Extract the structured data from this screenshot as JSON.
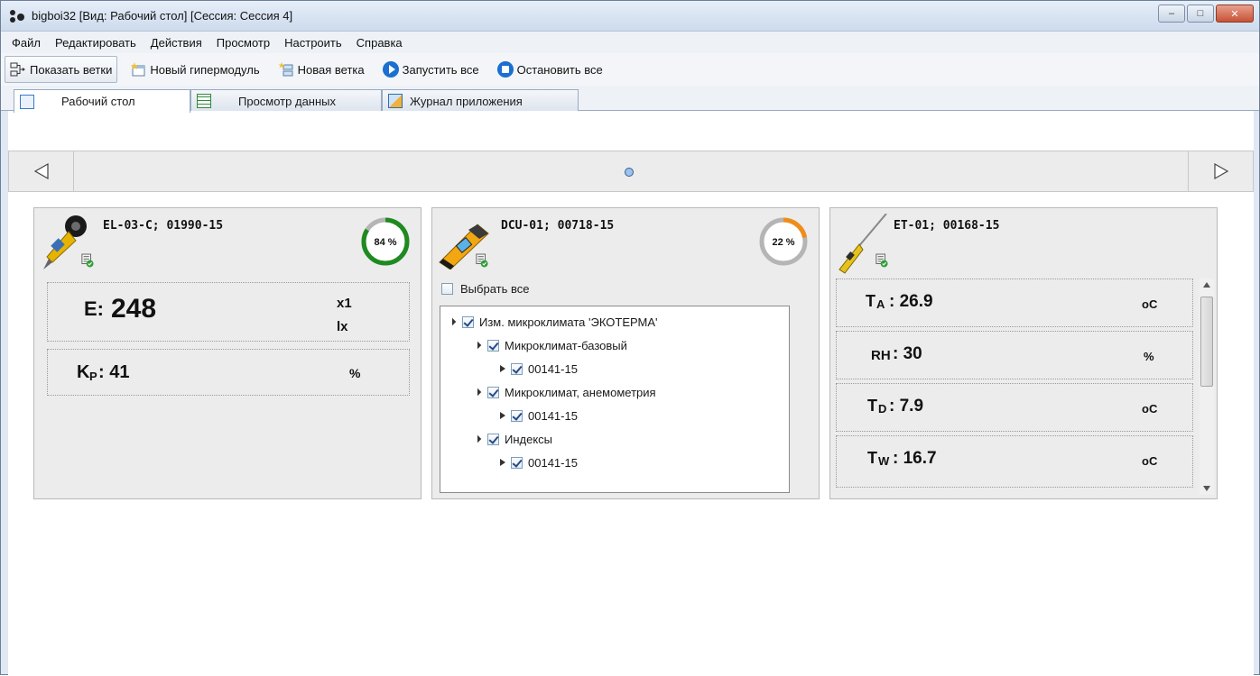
{
  "window": {
    "title": "bigboi32 [Вид: Рабочий стол] [Сессия: Сессия 4]",
    "buttons": {
      "minimize": "–",
      "maximize": "□",
      "close": "✕"
    }
  },
  "menu": [
    "Файл",
    "Редактировать",
    "Действия",
    "Просмотр",
    "Настроить",
    "Справка"
  ],
  "toolbar": {
    "show_branches": "Показать ветки",
    "new_hypermodule": "Новый гипермодуль",
    "new_branch": "Новая ветка",
    "start_all": "Запустить все",
    "stop_all": "Остановить все"
  },
  "tabs": [
    "Рабочий стол",
    "Просмотр данных",
    "Журнал приложения"
  ],
  "nav": {
    "left_arrow": "◁",
    "right_arrow": "▷"
  },
  "cards": {
    "el03": {
      "title": "EL-03-C; 01990-15",
      "progress_percent": 84,
      "progress_label": "84 %",
      "progress_color": "#1f8a1f",
      "readings": [
        {
          "label": "E:",
          "value": "248",
          "unit_line1": "x1",
          "unit_line2": "lx"
        },
        {
          "label": "K",
          "sub": "P",
          "value": ": 41",
          "unit": "%"
        }
      ]
    },
    "dcu01": {
      "title": "DCU-01; 00718-15",
      "progress_percent": 22,
      "progress_label": "22 %",
      "progress_color": "#f08c1a",
      "select_all": "Выбрать все",
      "tree": [
        {
          "level": 0,
          "expanded": true,
          "label": "Изм. микроклимата 'ЭКОТЕРМА'"
        },
        {
          "level": 1,
          "expanded": true,
          "label": "Микроклимат-базовый"
        },
        {
          "level": 2,
          "expanded": false,
          "label": "00141-15"
        },
        {
          "level": 1,
          "expanded": true,
          "label": "Микроклимат, анемометрия"
        },
        {
          "level": 2,
          "expanded": false,
          "label": "00141-15"
        },
        {
          "level": 1,
          "expanded": true,
          "label": "Индексы"
        },
        {
          "level": 2,
          "expanded": false,
          "label": "00141-15"
        }
      ]
    },
    "et01": {
      "title": "ET-01; 00168-15",
      "readings": [
        {
          "label": "T",
          "sub": "A",
          "value": ": 26.9",
          "unit": "oC"
        },
        {
          "label": "RH",
          "sub": "",
          "value": ": 30",
          "unit": "%"
        },
        {
          "label": "T",
          "sub": "D",
          "value": ": 7.9",
          "unit": "oC"
        },
        {
          "label": "T",
          "sub": "W",
          "value": ": 16.7",
          "unit": "oC"
        }
      ]
    }
  }
}
